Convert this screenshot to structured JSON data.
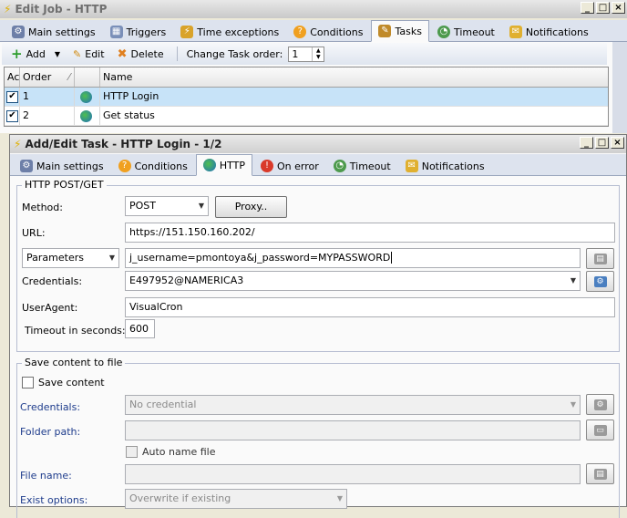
{
  "outer": {
    "title": "Edit Job - HTTP",
    "tabs": [
      {
        "label": "Main settings",
        "icon": "main-settings-icon"
      },
      {
        "label": "Triggers",
        "icon": "triggers-icon"
      },
      {
        "label": "Time exceptions",
        "icon": "time-exceptions-icon"
      },
      {
        "label": "Conditions",
        "icon": "conditions-icon"
      },
      {
        "label": "Tasks",
        "icon": "tasks-icon"
      },
      {
        "label": "Timeout",
        "icon": "timeout-icon"
      },
      {
        "label": "Notifications",
        "icon": "notifications-icon"
      }
    ],
    "active_tab": "Tasks",
    "toolbar": {
      "add": "Add",
      "edit": "Edit",
      "delete": "Delete",
      "change_order_label": "Change Task order:",
      "order_value": "1"
    },
    "grid": {
      "columns": [
        "Ac",
        "Order",
        "Name"
      ],
      "rows": [
        {
          "checked": true,
          "order": "1",
          "name": "HTTP Login"
        },
        {
          "checked": true,
          "order": "2",
          "name": "Get status"
        }
      ]
    }
  },
  "inner": {
    "title": "Add/Edit Task - HTTP Login - 1/2",
    "tabs": [
      {
        "label": "Main settings",
        "icon": "main-settings-icon"
      },
      {
        "label": "Conditions",
        "icon": "conditions-icon"
      },
      {
        "label": "HTTP",
        "icon": "globe-icon"
      },
      {
        "label": "On error",
        "icon": "error-icon"
      },
      {
        "label": "Timeout",
        "icon": "timeout-icon"
      },
      {
        "label": "Notifications",
        "icon": "notifications-icon"
      }
    ],
    "active_tab": "HTTP",
    "http_group": {
      "title": "HTTP POST/GET",
      "method_label": "Method:",
      "method_value": "POST",
      "proxy_button": "Proxy..",
      "url_label": "URL:",
      "url_value": "https://151.150.160.202/",
      "params_select": "Parameters",
      "params_value": "j_username=pmontoya&j_password=MYPASSWORD",
      "credentials_label": "Credentials:",
      "credentials_value": "E497952@NAMERICA3",
      "useragent_label": "UserAgent:",
      "useragent_value": "VisualCron",
      "timeout_label": "Timeout in seconds:",
      "timeout_value": "600"
    },
    "save_group": {
      "title": "Save content to file",
      "save_content_label": "Save content",
      "credentials_label": "Credentials:",
      "credentials_value": "No credential",
      "folder_label": "Folder path:",
      "auto_name_label": "Auto name file",
      "filename_label": "File name:",
      "exist_label": "Exist options:",
      "exist_value": "Overwrite if existing"
    }
  },
  "colors": {
    "tab_bg": "#dde3ee",
    "selected_row": "#c7e3f8",
    "blue_label": "#1e3c8c"
  }
}
